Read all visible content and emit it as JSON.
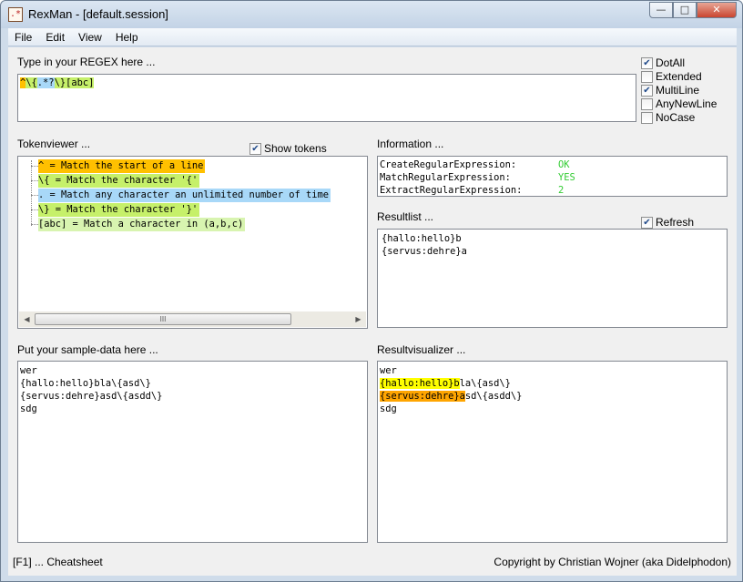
{
  "window": {
    "title": "RexMan - [default.session]",
    "icon_glyph": ".*",
    "buttons": {
      "minimize": "—",
      "maximize": "□",
      "close": "✕"
    }
  },
  "menu": [
    "File",
    "Edit",
    "View",
    "Help"
  ],
  "regex": {
    "label": "Type in your REGEX here ...",
    "segments": [
      {
        "text": "^",
        "color": "#ffc000"
      },
      {
        "text": "\\{",
        "color": "#c6f06a"
      },
      {
        "text": ".*?",
        "color": "#a8d8f8"
      },
      {
        "text": "\\}",
        "color": "#c6f06a"
      },
      {
        "text": "[abc]",
        "color": "#c6f06a"
      }
    ]
  },
  "options": [
    {
      "label": "DotAll",
      "checked": true
    },
    {
      "label": "Extended",
      "checked": false
    },
    {
      "label": "MultiLine",
      "checked": true
    },
    {
      "label": "AnyNewLine",
      "checked": false
    },
    {
      "label": "NoCase",
      "checked": false
    }
  ],
  "tokenviewer": {
    "label": "Tokenviewer ...",
    "show_tokens_label": "Show tokens",
    "show_tokens_checked": true,
    "tokens": [
      {
        "text": "^ = Match the start of a line",
        "color": "#ffc000"
      },
      {
        "text": "\\{ = Match the character '{'",
        "color": "#c6f06a"
      },
      {
        "text": ". = Match any character an unlimited number of time",
        "color": "#a8d8f8"
      },
      {
        "text": "\\} = Match the character '}'",
        "color": "#c6f06a"
      },
      {
        "text": "[abc] = Match a character in (a,b,c)",
        "color": "#d8f4b0"
      }
    ],
    "scroll_thumb_glyph": "III",
    "scroll_left_glyph": "◀",
    "scroll_right_glyph": "▶"
  },
  "information": {
    "label": "Information ...",
    "rows": [
      {
        "key": "CreateRegularExpression:",
        "value": "OK"
      },
      {
        "key": "MatchRegularExpression:",
        "value": "YES"
      },
      {
        "key": "ExtractRegularExpression:",
        "value": "2"
      }
    ],
    "value_color": "#33cc33"
  },
  "resultlist": {
    "label": "Resultlist ...",
    "refresh_label": "Refresh",
    "refresh_checked": true,
    "lines": [
      "{hallo:hello}b",
      "{servus:dehre}a"
    ]
  },
  "sample": {
    "label": "Put your sample-data here ...",
    "lines": [
      "wer",
      "{hallo:hello}bla\\{asd\\}",
      "{servus:dehre}asd\\{asdd\\}",
      "sdg"
    ]
  },
  "visualizer": {
    "label": "Resultvisualizer ...",
    "lines": [
      {
        "match": "",
        "rest": "wer",
        "color": ""
      },
      {
        "match": "{hallo:hello}b",
        "rest": "la\\{asd\\}",
        "color": "#ffff00"
      },
      {
        "match": "{servus:dehre}a",
        "rest": "sd\\{asdd\\}",
        "color": "#ffa500"
      },
      {
        "match": "",
        "rest": "sdg",
        "color": ""
      }
    ]
  },
  "statusbar": {
    "left": "[F1] ... Cheatsheet",
    "right": "Copyright by Christian Wojner (aka Didelphodon)"
  }
}
